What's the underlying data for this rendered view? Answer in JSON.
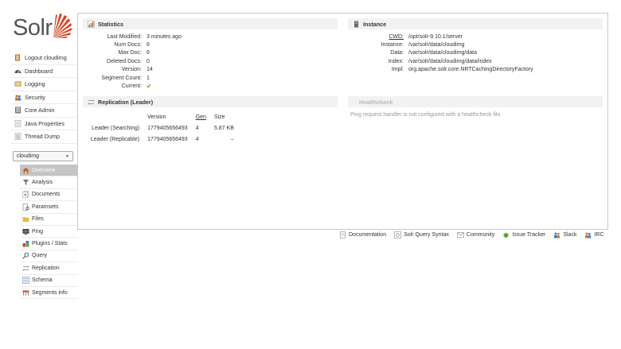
{
  "logo": {
    "text": "Solr"
  },
  "nav": {
    "items": [
      {
        "label": "Logout cloudimg"
      },
      {
        "label": "Dashboard"
      },
      {
        "label": "Logging"
      },
      {
        "label": "Security"
      },
      {
        "label": "Core Admin"
      },
      {
        "label": "Java Properties"
      },
      {
        "label": "Thread Dump"
      }
    ]
  },
  "core_selector": {
    "selected": "cloudimg"
  },
  "core_menu": {
    "items": [
      {
        "label": "Overview",
        "active": true
      },
      {
        "label": "Analysis"
      },
      {
        "label": "Documents"
      },
      {
        "label": "Paramsets"
      },
      {
        "label": "Files"
      },
      {
        "label": "Ping"
      },
      {
        "label": "Plugins / Stats"
      },
      {
        "label": "Query"
      },
      {
        "label": "Replication"
      },
      {
        "label": "Schema"
      },
      {
        "label": "Segments info"
      }
    ]
  },
  "statistics": {
    "title": "Statistics",
    "rows": [
      {
        "key": "Last Modified:",
        "value": "3 minutes ago"
      },
      {
        "key": "Num Docs:",
        "value": "6"
      },
      {
        "key": "Max Doc:",
        "value": "6"
      },
      {
        "key": "Deleted Docs:",
        "value": "0"
      },
      {
        "key": "Version:",
        "value": "14"
      },
      {
        "key": "Segment Count:",
        "value": "1"
      },
      {
        "key": "Current:",
        "value": "✔"
      }
    ]
  },
  "instance": {
    "title": "Instance",
    "rows": [
      {
        "key": "CWD:",
        "value": "/opt/solr-9.10.1/server"
      },
      {
        "key": "Instance:",
        "value": "/var/solr/data/cloudimg"
      },
      {
        "key": "Data:",
        "value": "/var/solr/data/cloudimg/data"
      },
      {
        "key": "Index:",
        "value": "/var/solr/data/cloudimg/data/index"
      },
      {
        "key": "Impl:",
        "value": "org.apache.solr.core.NRTCachingDirectoryFactory"
      }
    ]
  },
  "replication": {
    "title": "Replication (Leader)",
    "headers": {
      "version": "Version",
      "gen": "Gen",
      "size": "Size"
    },
    "rows": [
      {
        "label": "Leader (Searching)",
        "version": "1779405656493",
        "gen": "4",
        "size": "5.87 KB"
      },
      {
        "label": "Leader (Replicable)",
        "version": "1779405656493",
        "gen": "4",
        "size": "–"
      }
    ]
  },
  "healthcheck": {
    "title": "Healthcheck",
    "message": "Ping request handler is not configured with a healthcheck file."
  },
  "footer": {
    "links": [
      {
        "label": "Documentation"
      },
      {
        "label": "Solr Query Syntax"
      },
      {
        "label": "Community"
      },
      {
        "label": "Issue Tracker"
      },
      {
        "label": "Slack"
      },
      {
        "label": "IRC"
      }
    ]
  },
  "colors": {
    "accent": "#d9411e",
    "active_bg": "#c4c4c4",
    "header_bg": "#f2f2f2",
    "check": "#4caf1d"
  }
}
